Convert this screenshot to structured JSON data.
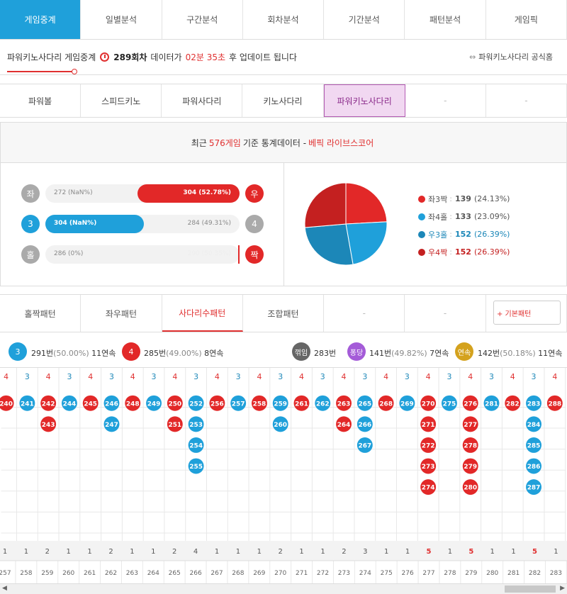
{
  "colors": {
    "red": "#e22828",
    "blue": "#1fa0da",
    "darkblue": "#1c87b8",
    "darkred": "#c42020",
    "grey": "#aaa",
    "purple": "#a45bd8",
    "gold": "#d4a21e",
    "darkgrey": "#666"
  },
  "main_tabs": [
    "게임중계",
    "일별분석",
    "구간분석",
    "회차분석",
    "기간분석",
    "패턴분석",
    "게임픽"
  ],
  "info": {
    "game": "파워키노사다리 게임중계",
    "round": "289회차",
    "data_is": "데이터가",
    "time": "02분 35초",
    "after": "후 업데이트 됩니다",
    "official": "파워키노사다리 공식홈"
  },
  "game_tabs": [
    "파워볼",
    "스피드키노",
    "파워사다리",
    "키노사다리",
    "파워키노사다리",
    "-",
    "-"
  ],
  "stat_header": {
    "pre": "최근",
    "count": "576게임",
    "mid": "기준 통계데이터 -",
    "source": "베픽 라이브스코어"
  },
  "bars": [
    {
      "left_label": "좌",
      "left_text": "272 (NaN%)",
      "right_text": "304 (52.78%)",
      "right_label": "우"
    },
    {
      "left_label": "3",
      "left_text": "304 (NaN%)",
      "right_text": "284 (49.31%)",
      "right_label": "4"
    },
    {
      "left_label": "홀",
      "left_text": "286 (0%)",
      "right_text": "290 (50.35%)",
      "right_label": "짝"
    }
  ],
  "pie_legend": [
    {
      "label": "좌3짝",
      "count": "139",
      "pct": "(24.13%)",
      "color": "#e22828"
    },
    {
      "label": "좌4홀",
      "count": "133",
      "pct": "(23.09%)",
      "color": "#1fa0da"
    },
    {
      "label": "우3홀",
      "count": "152",
      "pct": "(26.39%)",
      "color": "#1c87b8"
    },
    {
      "label": "우4짝",
      "count": "152",
      "pct": "(26.39%)",
      "color": "#c42020"
    }
  ],
  "pattern_tabs": [
    "홀짝패턴",
    "좌우패턴",
    "사다리수패턴",
    "조합패턴",
    "-",
    "-"
  ],
  "plus_button": "+ 기본패턴",
  "summary": {
    "three": {
      "ball": "3",
      "count": "291번",
      "pct": "(50.00%)",
      "streak": "11연속"
    },
    "four": {
      "ball": "4",
      "count": "285번",
      "pct": "(49.00%)",
      "streak": "8연속"
    },
    "jam": {
      "ball": "꺾임",
      "count": "283번"
    },
    "pong": {
      "ball": "퐁당",
      "count": "141번",
      "pct": "(49.82%)",
      "streak": "7연속"
    },
    "yeon": {
      "ball": "연속",
      "count": "142번",
      "pct": "(50.18%)",
      "streak": "11연속"
    }
  },
  "columns": [
    {
      "type": "4",
      "nums": [
        "240"
      ],
      "count": "1",
      "round": "257"
    },
    {
      "type": "3",
      "nums": [
        "241"
      ],
      "count": "1",
      "round": "258"
    },
    {
      "type": "4",
      "nums": [
        "242",
        "243"
      ],
      "count": "2",
      "round": "259"
    },
    {
      "type": "3",
      "nums": [
        "244"
      ],
      "count": "1",
      "round": "260"
    },
    {
      "type": "4",
      "nums": [
        "245"
      ],
      "count": "1",
      "round": "261"
    },
    {
      "type": "3",
      "nums": [
        "246",
        "247"
      ],
      "count": "2",
      "round": "262"
    },
    {
      "type": "4",
      "nums": [
        "248"
      ],
      "count": "1",
      "round": "263"
    },
    {
      "type": "3",
      "nums": [
        "249"
      ],
      "count": "1",
      "round": "264"
    },
    {
      "type": "4",
      "nums": [
        "250",
        "251"
      ],
      "count": "2",
      "round": "265"
    },
    {
      "type": "3",
      "nums": [
        "252",
        "253",
        "254",
        "255"
      ],
      "count": "4",
      "round": "266"
    },
    {
      "type": "4",
      "nums": [
        "256"
      ],
      "count": "1",
      "round": "267"
    },
    {
      "type": "3",
      "nums": [
        "257"
      ],
      "count": "1",
      "round": "268"
    },
    {
      "type": "4",
      "nums": [
        "258"
      ],
      "count": "1",
      "round": "269"
    },
    {
      "type": "3",
      "nums": [
        "259",
        "260"
      ],
      "count": "2",
      "round": "270"
    },
    {
      "type": "4",
      "nums": [
        "261"
      ],
      "count": "1",
      "round": "271"
    },
    {
      "type": "3",
      "nums": [
        "262"
      ],
      "count": "1",
      "round": "272"
    },
    {
      "type": "4",
      "nums": [
        "263",
        "264"
      ],
      "count": "2",
      "round": "273"
    },
    {
      "type": "3",
      "nums": [
        "265",
        "266",
        "267"
      ],
      "count": "3",
      "round": "274"
    },
    {
      "type": "4",
      "nums": [
        "268"
      ],
      "count": "1",
      "round": "275"
    },
    {
      "type": "3",
      "nums": [
        "269"
      ],
      "count": "1",
      "round": "276"
    },
    {
      "type": "4",
      "nums": [
        "270",
        "271",
        "272",
        "273",
        "274"
      ],
      "count": "5",
      "round": "277"
    },
    {
      "type": "3",
      "nums": [
        "275"
      ],
      "count": "1",
      "round": "278"
    },
    {
      "type": "4",
      "nums": [
        "276",
        "277",
        "278",
        "279",
        "280"
      ],
      "count": "5",
      "round": "279"
    },
    {
      "type": "3",
      "nums": [
        "281"
      ],
      "count": "1",
      "round": "280"
    },
    {
      "type": "4",
      "nums": [
        "282"
      ],
      "count": "1",
      "round": "281"
    },
    {
      "type": "3",
      "nums": [
        "283",
        "284",
        "285",
        "286",
        "287"
      ],
      "count": "5",
      "round": "282"
    },
    {
      "type": "4",
      "nums": [
        "288"
      ],
      "count": "1",
      "round": "283"
    }
  ],
  "scroll": {
    "left": "◀",
    "right": "▶"
  }
}
